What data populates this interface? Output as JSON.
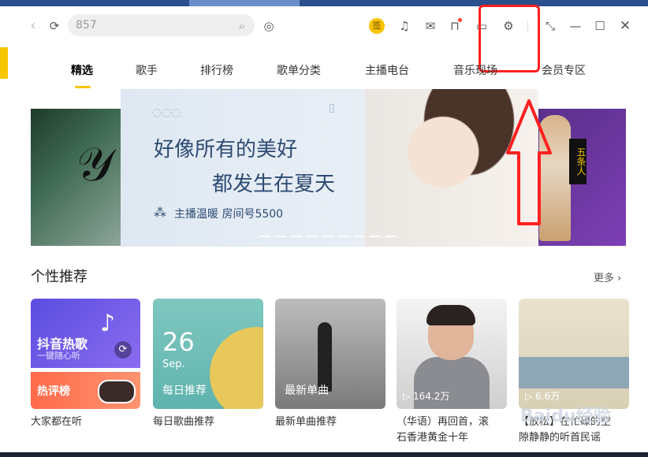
{
  "search": {
    "value": "857"
  },
  "header": {
    "sign_badge": "签"
  },
  "nav": {
    "tabs": [
      "精选",
      "歌手",
      "排行榜",
      "歌单分类",
      "主播电台",
      "音乐现场",
      "会员专区"
    ],
    "active_index": 0
  },
  "banner": {
    "line1": "好像所有的美好",
    "line2": "都发生在夏天",
    "line3": "主播温暖  房间号5500",
    "right_tag": "五条人"
  },
  "section": {
    "title": "个性推荐",
    "more": "更多"
  },
  "cards": [
    {
      "top_title": "抖音热歌",
      "top_sub": "一键随心听",
      "bottom_title": "热评榜",
      "caption": "大家都在听"
    },
    {
      "day": "26",
      "month": "Sep.",
      "label": "每日推荐",
      "caption": "每日歌曲推荐"
    },
    {
      "label": "最新单曲",
      "caption": "最新单曲推荐"
    },
    {
      "plays": "164.2万",
      "caption_line1": "（华语）再回首，滚",
      "caption_line2": "石香港黄金十年"
    },
    {
      "plays": "6.6万",
      "caption_line1": "【放松】在忙碌的空",
      "caption_line2": "隙静静的听首民谣"
    }
  ],
  "watermark": "Baidu经验",
  "colors": {
    "accent": "#f5c400",
    "annotation": "#ff2020",
    "title_blue": "#2d4b73"
  }
}
